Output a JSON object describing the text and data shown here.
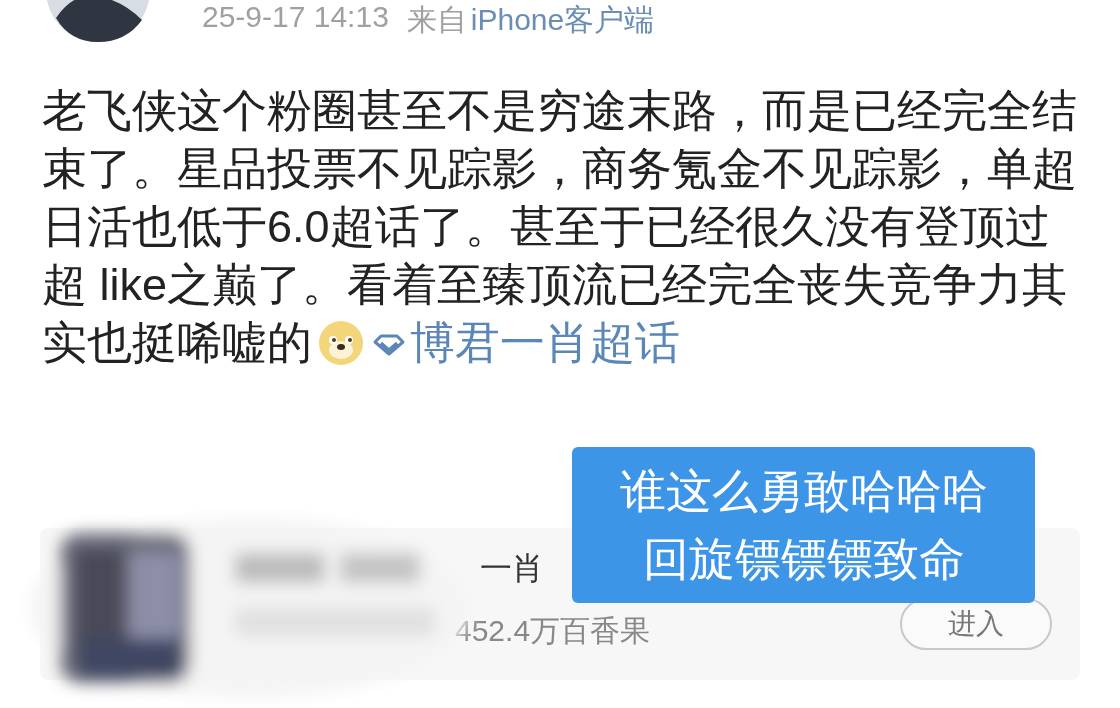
{
  "post": {
    "time": "25-9-17 14:13",
    "source_prefix": "来自",
    "source": "iPhone客户端",
    "text": "老飞侠这个粉圈甚至不是穷途末路，而是已经完全结束了。星品投票不见踪影，商务氪金不见踪影，单超日活也低于6.0超话了。甚至于已经很久没有登顶过超 like之巅了。看着至臻顶流已经完全丧失竞争力其实也挺唏嘘的",
    "topic": "博君一肖超话"
  },
  "card": {
    "name": "一肖",
    "count": "452.4万百香果",
    "button": "进入"
  },
  "caption": {
    "lines": [
      "谁这么勇敢哈哈哈",
      "回旋镖镖镖致命"
    ]
  }
}
